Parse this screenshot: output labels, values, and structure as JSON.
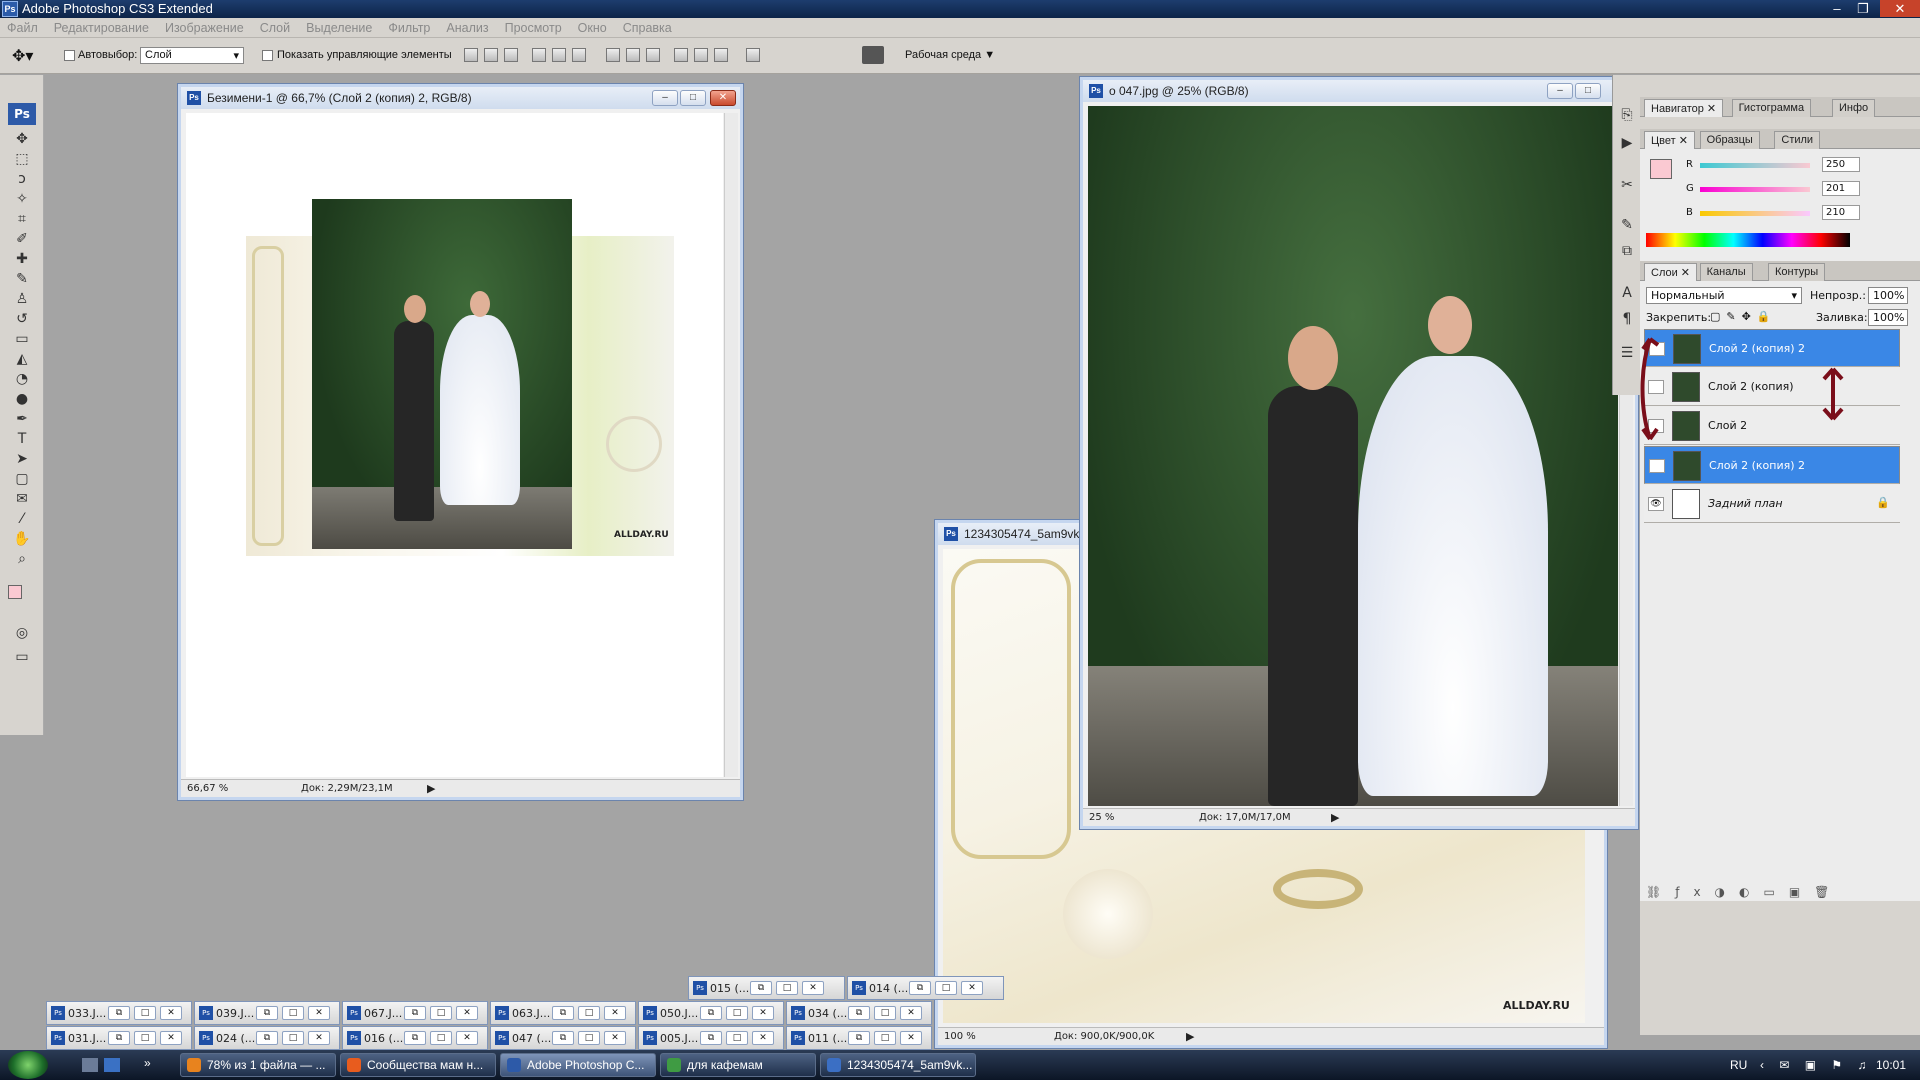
{
  "app": {
    "title": "Adobe Photoshop CS3 Extended",
    "logo": "Ps"
  },
  "menu": [
    "Файл",
    "Редактирование",
    "Изображение",
    "Слой",
    "Выделение",
    "Фильтр",
    "Анализ",
    "Просмотр",
    "Окно",
    "Справка"
  ],
  "options": {
    "autoselect_label": "Автовыбор:",
    "autoselect_value": "Слой",
    "show_controls_label": "Показать управляющие элементы",
    "workspace_label": "Рабочая среда"
  },
  "windows": {
    "doc1": {
      "title": "Безимени-1 @ 66,7% (Слой 2 (копия) 2, RGB/8)",
      "zoom": "66,67 %",
      "doc": "Док: 2,29M/23,1M",
      "watermark": "ALLDAY.RU"
    },
    "doc2": {
      "title": "о 047.jpg @ 25% (RGB/8)",
      "zoom": "25 %",
      "doc": "Док: 17,0M/17,0M"
    },
    "doc3": {
      "title": "1234305474_5am9vk.jpg",
      "zoom": "100 %",
      "doc": "Док: 900,0K/900,0K",
      "watermark": "ALLDAY.RU"
    }
  },
  "panels": {
    "nav_tabs": [
      "Навигатор",
      "Гистограмма",
      "Инфо"
    ],
    "color_tabs": [
      "Цвет",
      "Образцы",
      "Стили"
    ],
    "color": {
      "r_label": "R",
      "g_label": "G",
      "b_label": "B",
      "r": "250",
      "g": "201",
      "b": "210",
      "swatch": "#fac9d2"
    },
    "layers_tabs": [
      "Слои",
      "Каналы",
      "Контуры"
    ],
    "blend_mode": "Нормальный",
    "opacity_label": "Непрозр.:",
    "opacity": "100%",
    "lock_label": "Закрепить:",
    "fill_label": "Заливка:",
    "fill": "100%",
    "layers": [
      {
        "name": "Слой 2 (копия) 2",
        "selected": true
      },
      {
        "name": "Слой 2 (копия)",
        "selected": false
      },
      {
        "name": "Слой 2",
        "selected": false
      },
      {
        "name": "Слой 2 (копия) 2",
        "selected": true
      },
      {
        "name": "Задний план",
        "selected": false
      }
    ]
  },
  "tray": {
    "row1": [
      "015 (...",
      "014 (..."
    ],
    "row2": [
      "033.J...",
      "039.J...",
      "067.J...",
      "063.J...",
      "050.J...",
      "034 (..."
    ],
    "row3": [
      "031.J...",
      "024 (...",
      "016 (...",
      "047 (...",
      "005.J...",
      "011 (..."
    ]
  },
  "taskbar": {
    "items": [
      "78% из 1 файла — ...",
      "Сообщества мам н...",
      "Adobe Photoshop C...",
      "для кафемам",
      "1234305474_5am9vk..."
    ],
    "lang": "RU",
    "time": "10:01"
  },
  "colors": {
    "accent": "#3a87e6",
    "arrow": "#7a0e1a"
  }
}
